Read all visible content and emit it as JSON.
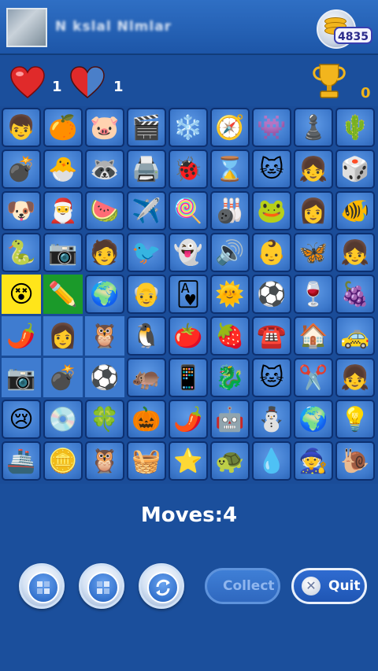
{
  "player": {
    "name": "N kslal Nlmlar",
    "coins": "4835"
  },
  "stats": {
    "lives": "1",
    "half_lives": "1",
    "trophies": "0"
  },
  "moves": {
    "label": "Moves:",
    "value": "4"
  },
  "buttons": {
    "collect": "Collect",
    "quit": "Quit",
    "quit_icon": "close-icon"
  },
  "colors": {
    "background": "#1b4f9c",
    "selection_yellow": "#ffe51a",
    "selection_green": "#1b9a2a",
    "trophy_count": "#f0b41a"
  },
  "board": {
    "rows": [
      [
        "blond-boy",
        "orange-fruit",
        "pink-pig",
        "clapperboard",
        "snowflake",
        "compass",
        "purple-alien",
        "chess-pawn",
        "cactus"
      ],
      [
        "bomb",
        "chick",
        "raccoon",
        "printer",
        "ladybug",
        "hourglass",
        "gray-cat",
        "blond-girl",
        "dice"
      ],
      [
        "puppy",
        "santa",
        "watermelon",
        "crashed-plane",
        "lollipop",
        "bowling-ball",
        "green-frog",
        "blue-hair-girl",
        "goldfish"
      ],
      [
        "snake",
        "camera",
        "dark-hair-boy",
        "blue-bird",
        "ghost",
        "speaker",
        "baby",
        "butterfly",
        "brown-hair-girl"
      ],
      [
        "blue-face",
        "pencil",
        "globe",
        "gray-hair-boy",
        "ace-of-hearts",
        "sun",
        "soccer-ball",
        "wine-glass",
        "grapes"
      ],
      [
        "chili-pepper",
        "blue-hair-girl",
        "owl",
        "penguin",
        "tomato",
        "strawberry",
        "telephone",
        "house",
        "taxi"
      ],
      [
        "camera",
        "bomb",
        "soccer-ball",
        "hippo",
        "phone-chart",
        "blue-dragon",
        "gray-cat",
        "scissors",
        "girl-doll"
      ],
      [
        "crying-face",
        "refresh-disc",
        "clover",
        "pumpkin",
        "chili-pepper",
        "robot",
        "snowman",
        "globe",
        "lightbulb"
      ],
      [
        "cruise-ship",
        "gold-coin",
        "owl",
        "iron",
        "starfish",
        "turtle",
        "water-drop",
        "witch-girl",
        "snail"
      ]
    ],
    "glyphs": {
      "blond-boy": "👦",
      "orange-fruit": "🍊",
      "pink-pig": "🐷",
      "clapperboard": "🎬",
      "snowflake": "❄️",
      "compass": "🧭",
      "purple-alien": "👾",
      "chess-pawn": "♟️",
      "cactus": "🌵",
      "bomb": "💣",
      "chick": "🐣",
      "raccoon": "🦝",
      "printer": "🖨️",
      "ladybug": "🐞",
      "hourglass": "⌛",
      "gray-cat": "🐱",
      "blond-girl": "👧",
      "dice": "🎲",
      "puppy": "🐶",
      "santa": "🎅",
      "watermelon": "🍉",
      "crashed-plane": "✈️",
      "lollipop": "🍭",
      "bowling-ball": "🎳",
      "green-frog": "🐸",
      "blue-hair-girl": "👩",
      "goldfish": "🐠",
      "snake": "🐍",
      "camera": "📷",
      "dark-hair-boy": "🧑",
      "blue-bird": "🐦",
      "ghost": "👻",
      "speaker": "🔊",
      "baby": "👶",
      "butterfly": "🦋",
      "brown-hair-girl": "👧",
      "blue-face": "😵",
      "pencil": "✏️",
      "globe": "🌍",
      "gray-hair-boy": "👴",
      "ace-of-hearts": "🂱",
      "sun": "🌞",
      "soccer-ball": "⚽",
      "wine-glass": "🍷",
      "grapes": "🍇",
      "chili-pepper": "🌶️",
      "owl": "🦉",
      "penguin": "🐧",
      "tomato": "🍅",
      "strawberry": "🍓",
      "telephone": "☎️",
      "house": "🏠",
      "taxi": "🚕",
      "hippo": "🦛",
      "phone-chart": "📱",
      "blue-dragon": "🐉",
      "scissors": "✂️",
      "girl-doll": "👧",
      "crying-face": "😢",
      "refresh-disc": "💿",
      "clover": "🍀",
      "pumpkin": "🎃",
      "robot": "🤖",
      "snowman": "⛄",
      "lightbulb": "💡",
      "cruise-ship": "🚢",
      "gold-coin": "🪙",
      "iron": "🧺",
      "starfish": "⭐",
      "turtle": "🐢",
      "water-drop": "💧",
      "witch-girl": "🧙",
      "snail": "🐌"
    },
    "selected": [
      [
        4,
        0
      ],
      [
        4,
        1
      ]
    ],
    "cleared_region_rows": [
      5,
      6
    ]
  }
}
